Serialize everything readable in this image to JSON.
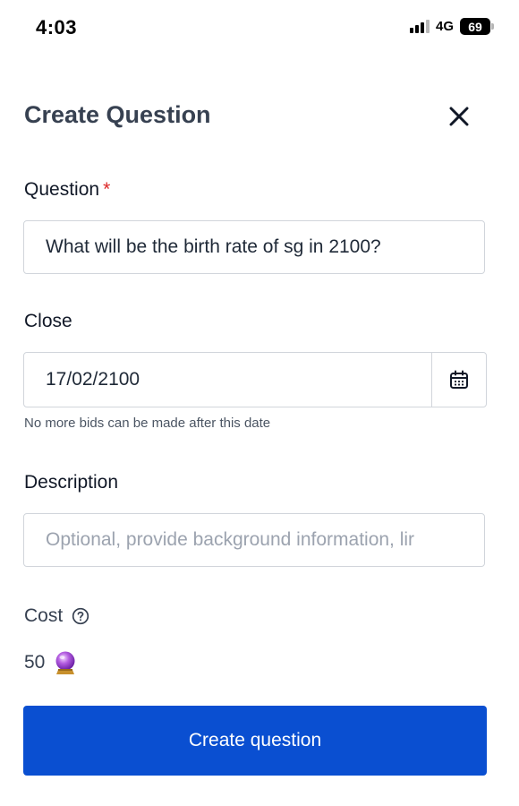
{
  "status_bar": {
    "time": "4:03",
    "network": "4G",
    "battery": "69"
  },
  "header": {
    "title": "Create Question"
  },
  "form": {
    "question": {
      "label": "Question",
      "required_mark": "*",
      "value": "What will be the birth rate of sg in 2100?"
    },
    "close": {
      "label": "Close",
      "value": "17/02/2100",
      "help": "No more bids can be made after this date"
    },
    "description": {
      "label": "Description",
      "placeholder": "Optional, provide background information, lir"
    },
    "cost": {
      "label": "Cost",
      "value": "50"
    },
    "submit_label": "Create question"
  },
  "icons": {
    "close": "close-icon",
    "calendar": "calendar-icon",
    "help": "help-circle-icon",
    "crystal_ball": "crystal-ball-icon"
  },
  "colors": {
    "primary": "#0a4fd1",
    "required": "#dc2626",
    "title": "#374151"
  }
}
